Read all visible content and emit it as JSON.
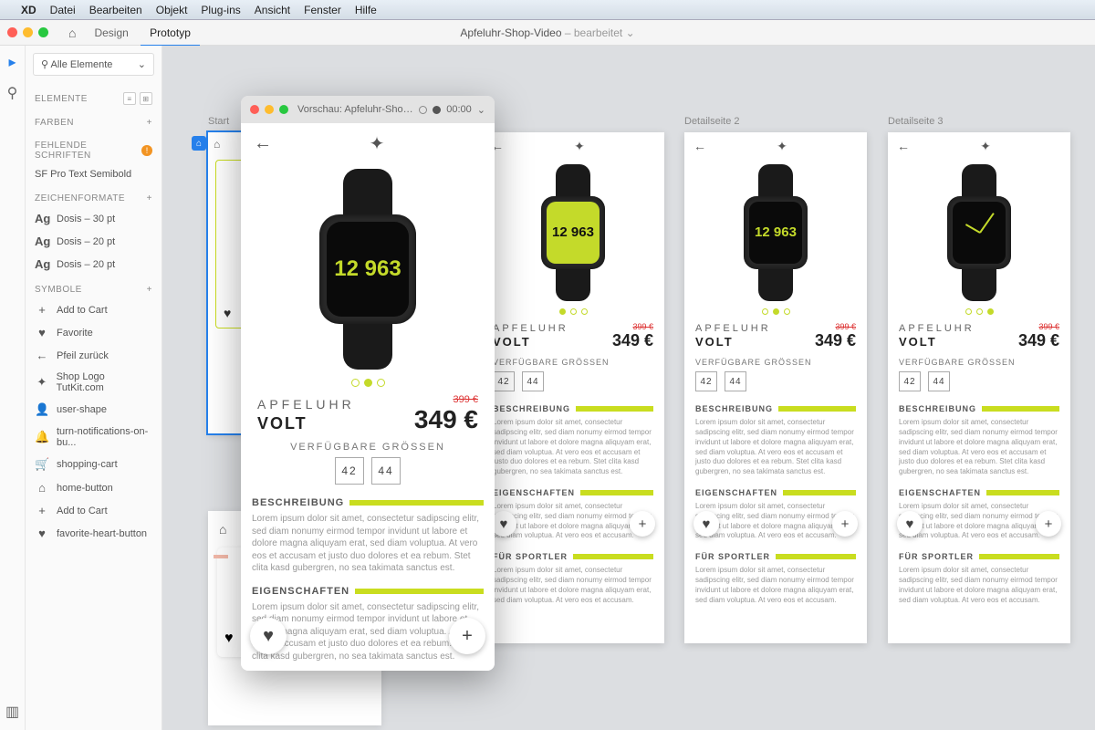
{
  "menubar": {
    "items": [
      "XD",
      "Datei",
      "Bearbeiten",
      "Objekt",
      "Plug-ins",
      "Ansicht",
      "Fenster",
      "Hilfe"
    ]
  },
  "appbar": {
    "modes": {
      "design": "Design",
      "prototype": "Prototyp"
    },
    "document": "Apfeluhr-Shop-Video",
    "doc_suffix": "– bearbeitet"
  },
  "leftpanel": {
    "search": {
      "placeholder": "Alle Elemente"
    },
    "sections": {
      "elements": "ELEMENTE",
      "colors": "Farben",
      "missing_fonts": "Fehlende Schriften",
      "char_styles": "Zeichenformate",
      "symbols": "Symbole"
    },
    "missing_font": "SF Pro Text Semibold",
    "char_styles_items": [
      "Dosis – 30 pt",
      "Dosis – 20 pt",
      "Dosis – 20 pt"
    ],
    "symbols": [
      {
        "icon": "+",
        "label": "Add to Cart"
      },
      {
        "icon": "♥",
        "label": "Favorite"
      },
      {
        "icon": "←",
        "label": "Pfeil zurück"
      },
      {
        "icon": "✦",
        "label": "Shop Logo TutKit.com"
      },
      {
        "icon": "👤",
        "label": "user-shape"
      },
      {
        "icon": "🔔",
        "label": "turn-notifications-on-bu..."
      },
      {
        "icon": "🛒",
        "label": "shopping-cart"
      },
      {
        "icon": "⌂",
        "label": "home-button"
      },
      {
        "icon": "+",
        "label": "Add to Cart"
      },
      {
        "icon": "♥",
        "label": "favorite-heart-button"
      }
    ]
  },
  "canvas": {
    "start_label": "Start",
    "detail_labels": [
      "",
      "Detailseite 2",
      "Detailseite 3"
    ],
    "product": {
      "brand": "APFELUHR",
      "model": "VOLT",
      "old_price": "399 €",
      "price": "349 €",
      "sizes_label": "VERFÜGBARE GRÖSSEN",
      "sizes": [
        "42",
        "44"
      ],
      "sec1": "BESCHREIBUNG",
      "sec2": "EIGENSCHAFTEN",
      "sec3": "FÜR SPORTLER",
      "lorem": "Lorem ipsum dolor sit amet, consectetur sadipscing elitr, sed diam nonumy eirmod tempor invidunt ut labore et dolore magna aliquyam erat, sed diam voluptua. At vero eos et accusam et justo duo dolores et ea rebum. Stet clita kasd gubergren, no sea takimata sanctus est.",
      "lorem2": "Lorem ipsum dolor sit amet, consectetur sadipscing elitr, sed diam nonumy eirmod tempor invidunt ut labore et dolore magna aliquyam erat, sed diam voluptua. At vero eos et accusam.",
      "watch_digits": "12\n963"
    }
  },
  "preview": {
    "title": "Vorschau: Apfeluhr-Shop-Video",
    "time": "00:00"
  }
}
